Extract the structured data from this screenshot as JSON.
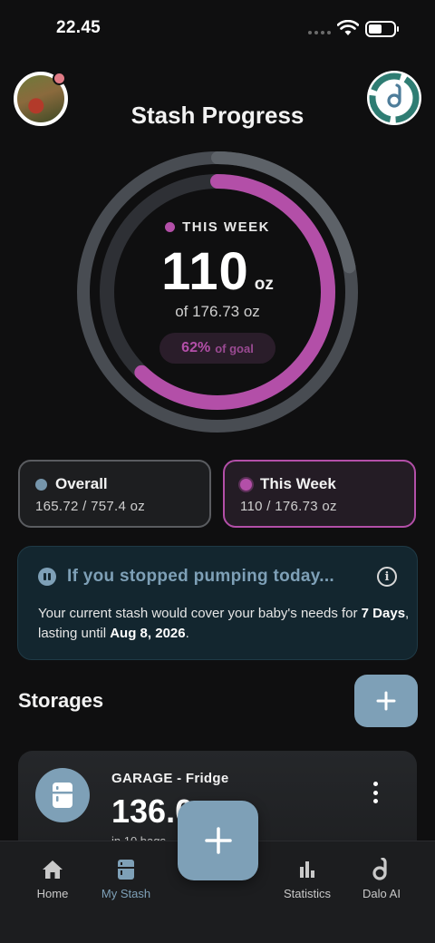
{
  "status_bar": {
    "time": "22.45"
  },
  "header": {
    "title": "Stash Progress"
  },
  "ring": {
    "label": "THIS WEEK",
    "value": "110",
    "unit": "oz",
    "of_text": "of 176.73 oz",
    "percent": "62%",
    "percent_suffix": "of goal",
    "week_progress": 0.62,
    "overall_progress": 0.22
  },
  "cards": {
    "overall": {
      "label": "Overall",
      "value": "165.72 / 757.4 oz"
    },
    "week": {
      "label": "This Week",
      "value": "110 / 176.73 oz"
    }
  },
  "info": {
    "title": "If you stopped pumping today...",
    "body_prefix": "Your current stash would cover your baby's needs for ",
    "days": "7 Days",
    "body_mid": ", lasting until ",
    "date": "Aug 8, 2026",
    "body_suffix": "."
  },
  "storages": {
    "title": "Storages",
    "items": [
      {
        "name": "GARAGE - Fridge",
        "value": "136.0",
        "sub": "in 10 bags"
      }
    ]
  },
  "tabs": [
    {
      "label": "Home",
      "icon": "home-icon"
    },
    {
      "label": "My Stash",
      "icon": "fridge-icon"
    },
    {
      "label": "Statistics",
      "icon": "bar-chart-icon"
    },
    {
      "label": "Dalo AI",
      "icon": "dalo-icon"
    }
  ],
  "colors": {
    "accent": "#7ea0b7",
    "week": "#b34fa8",
    "background": "#0f0f10"
  }
}
